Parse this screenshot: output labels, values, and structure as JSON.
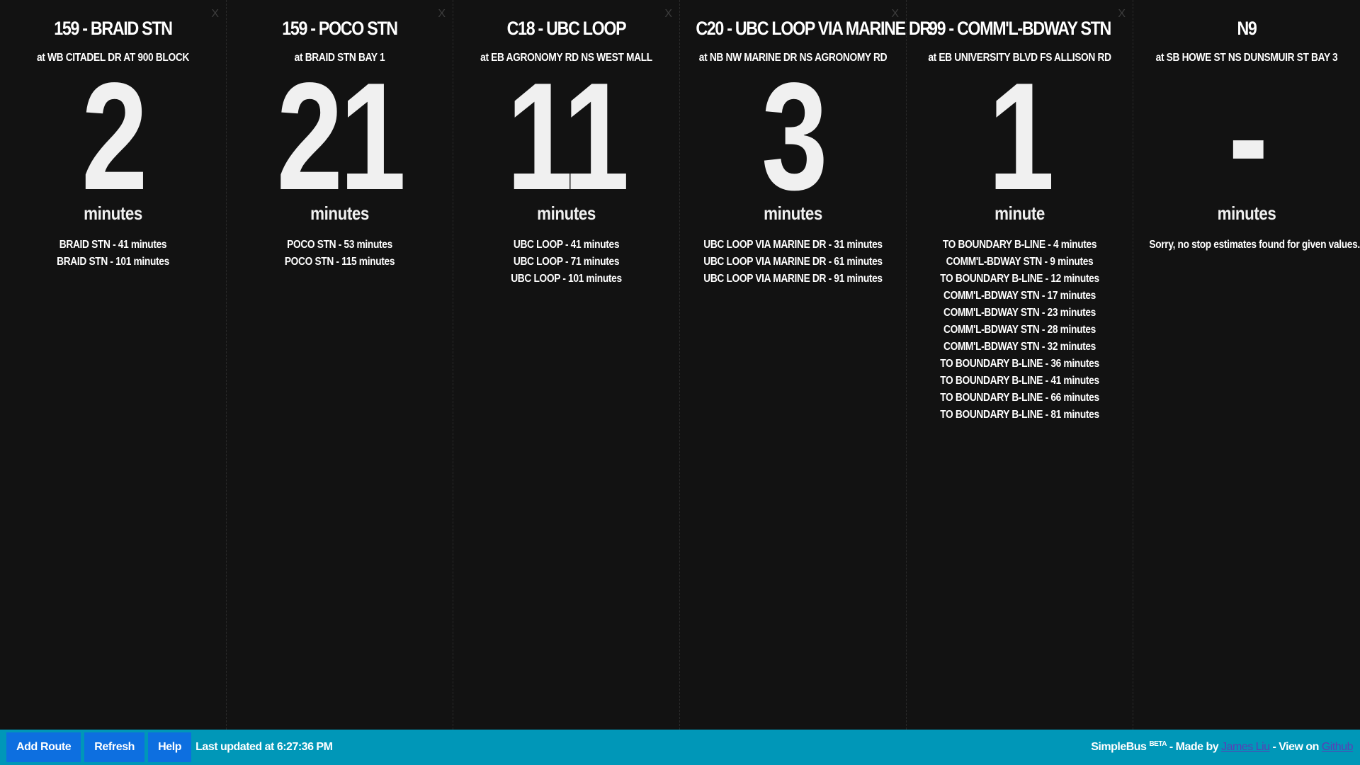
{
  "routes": [
    {
      "close_label": "X",
      "title": "159 - BRAID STN",
      "stop": "at WB CITADEL DR AT 900 BLOCK",
      "minutes": "2",
      "unit": "minutes",
      "estimates": [
        "BRAID STN - 41 minutes",
        "BRAID STN - 101 minutes"
      ]
    },
    {
      "close_label": "X",
      "title": "159 - POCO STN",
      "stop": "at BRAID STN BAY 1",
      "minutes": "21",
      "unit": "minutes",
      "estimates": [
        "POCO STN - 53 minutes",
        "POCO STN - 115 minutes"
      ]
    },
    {
      "close_label": "X",
      "title": "C18 - UBC LOOP",
      "stop": "at EB AGRONOMY RD NS WEST MALL",
      "minutes": "11",
      "unit": "minutes",
      "estimates": [
        "UBC LOOP - 41 minutes",
        "UBC LOOP - 71 minutes",
        "UBC LOOP - 101 minutes"
      ]
    },
    {
      "close_label": "X",
      "title": "C20 - UBC LOOP VIA MARINE DR",
      "stop": "at NB NW MARINE DR NS AGRONOMY RD",
      "minutes": "3",
      "unit": "minutes",
      "estimates": [
        "UBC LOOP VIA MARINE DR - 31 minutes",
        "UBC LOOP VIA MARINE DR - 61 minutes",
        "UBC LOOP VIA MARINE DR - 91 minutes"
      ]
    },
    {
      "close_label": "X",
      "title": "99 - COMM'L-BDWAY STN",
      "stop": "at EB UNIVERSITY BLVD FS ALLISON RD",
      "minutes": "1",
      "unit": "minute",
      "estimates": [
        "TO BOUNDARY B-LINE - 4 minutes",
        "COMM'L-BDWAY STN - 9 minutes",
        "TO BOUNDARY B-LINE - 12 minutes",
        "COMM'L-BDWAY STN - 17 minutes",
        "COMM'L-BDWAY STN - 23 minutes",
        "COMM'L-BDWAY STN - 28 minutes",
        "COMM'L-BDWAY STN - 32 minutes",
        "TO BOUNDARY B-LINE - 36 minutes",
        "TO BOUNDARY B-LINE - 41 minutes",
        "TO BOUNDARY B-LINE - 66 minutes",
        "TO BOUNDARY B-LINE - 81 minutes"
      ]
    },
    {
      "title": "N9",
      "stop": "at SB HOWE ST NS DUNSMUIR ST BAY 3",
      "minutes": "-",
      "unit": "minutes",
      "message": "Sorry, no stop estimates found for given values."
    }
  ],
  "footer": {
    "add_route": "Add Route",
    "refresh": "Refresh",
    "help": "Help",
    "last_updated": "Last updated at 6:27:36 PM",
    "app_name": "SimpleBus",
    "beta": "BETA",
    "made_by": " - Made by ",
    "author": "James Liu",
    "view_on": " - View on ",
    "github": "Github"
  },
  "colors": {
    "background": "#121212",
    "footer": "#0097b8",
    "button": "#0d6fe0",
    "link": "#5a3fb5"
  }
}
